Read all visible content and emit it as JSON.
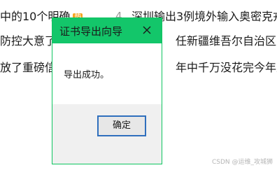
{
  "background": {
    "rows": [
      {
        "left_text": "中的10个明确",
        "badge": "热",
        "number": "4",
        "right_text": "深圳输出3例境外输入奥密克戎"
      },
      {
        "left_text": "防控大意了",
        "badge": "",
        "number": "",
        "right_text": "任新疆维吾尔自治区党"
      },
      {
        "left_text": "放了重磅信号",
        "badge": "",
        "number": "",
        "right_text": "年中千万没花完今年又"
      }
    ],
    "watermark": "CSDN @运维_攻城狮"
  },
  "dialog": {
    "title": "证书导出向导",
    "message": "导出成功。",
    "ok_label": "确定",
    "accent_color": "#13c66a"
  }
}
